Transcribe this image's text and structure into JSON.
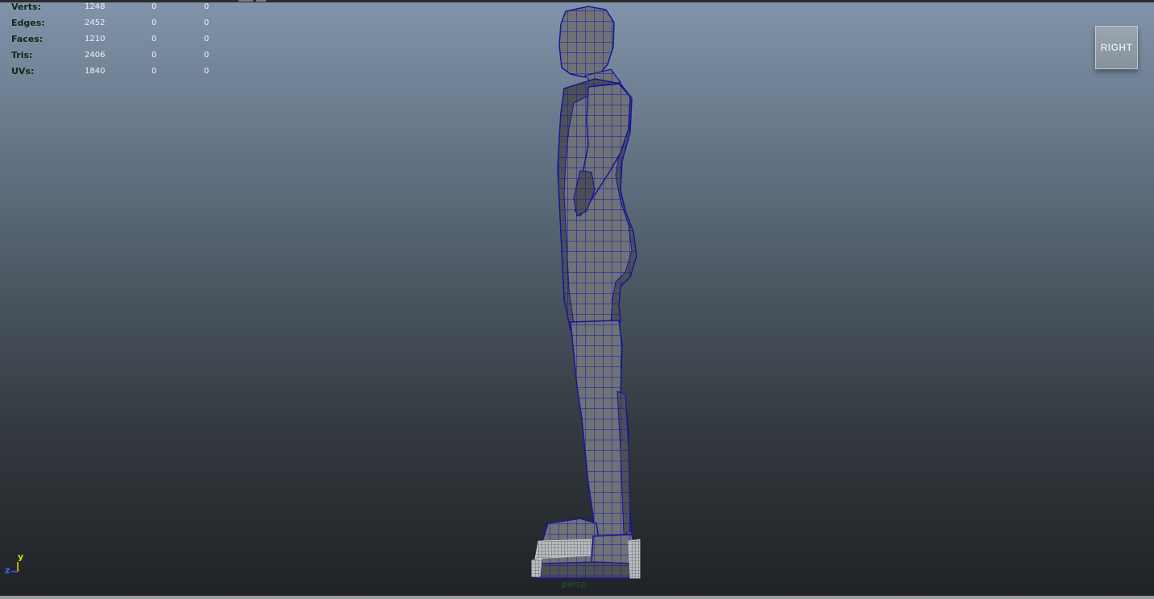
{
  "poly_count": {
    "rows": [
      {
        "label": "Verts:",
        "values": [
          "1248",
          "0",
          "0"
        ]
      },
      {
        "label": "Edges:",
        "values": [
          "2452",
          "0",
          "0"
        ]
      },
      {
        "label": "Faces:",
        "values": [
          "1210",
          "0",
          "0"
        ]
      },
      {
        "label": "Tris:",
        "values": [
          "2406",
          "0",
          "0"
        ]
      },
      {
        "label": "UVs:",
        "values": [
          "1840",
          "0",
          "0"
        ]
      }
    ]
  },
  "view_cube": {
    "label": "RIGHT"
  },
  "axis": {
    "y_label": "y",
    "z_label": "z"
  },
  "camera": {
    "name": "persp"
  },
  "colors": {
    "wireframe": "#16169a",
    "mesh_fill": "#6c6f74",
    "stat_label": "#0f2a14",
    "stat_value": "#f2f2f2",
    "axis_y": "#d9e000",
    "axis_z": "#2b6cff",
    "axis_x": "#e04040"
  },
  "icons": {
    "view_cube": "view-cube-icon",
    "axis": "axis-gizmo-icon"
  }
}
